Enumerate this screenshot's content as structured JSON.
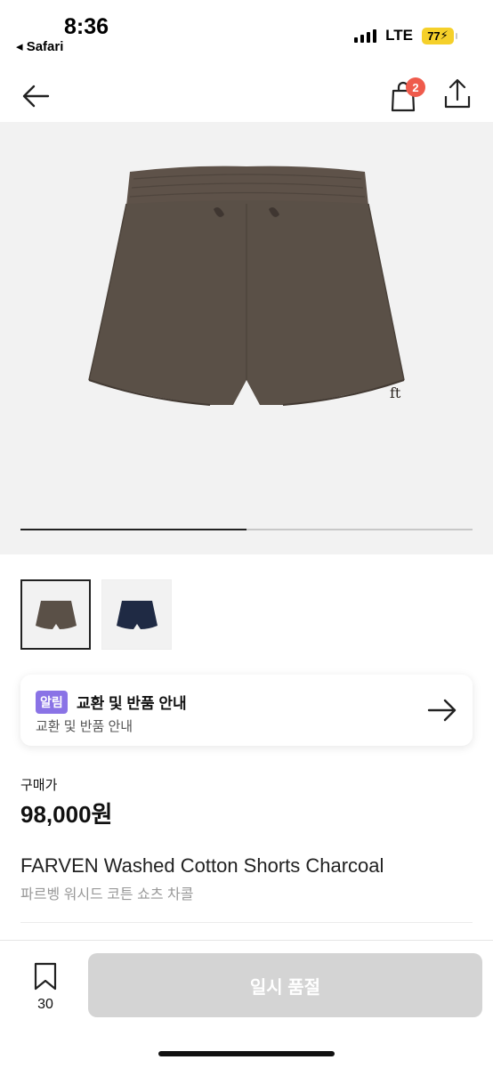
{
  "status_bar": {
    "time": "8:36",
    "back_app": "◂ Safari",
    "network": "LTE",
    "battery": "77"
  },
  "nav": {
    "back_icon": "arrow-left-icon",
    "cart_icon": "shopping-bag-icon",
    "cart_count": "2",
    "share_icon": "share-icon"
  },
  "gallery": {
    "progress": 0.5,
    "thumbnails": [
      {
        "name": "charcoal-shorts-thumb",
        "color": "#5a5047"
      },
      {
        "name": "navy-shorts-thumb",
        "color": "#1f2a44"
      }
    ]
  },
  "notice": {
    "tag": "알림",
    "title": "교환 및 반품 안내",
    "subtitle": "교환 및 반품 안내",
    "arrow_icon": "arrow-right-icon"
  },
  "price": {
    "label": "구매가",
    "value": "98,000원"
  },
  "product": {
    "title_en": "FARVEN Washed Cotton Shorts Charcoal",
    "title_ko": "파르벵 워시드 코튼 쇼츠 차콜"
  },
  "bottom_bar": {
    "wish_icon": "bookmark-icon",
    "wish_count": "30",
    "cta_label": "일시 품절"
  },
  "colors": {
    "accent_badge": "#ef5b4c",
    "notice_tag": "#8a73e6",
    "disabled_button": "#d4d4d4",
    "product_charcoal": "#5a5047"
  }
}
